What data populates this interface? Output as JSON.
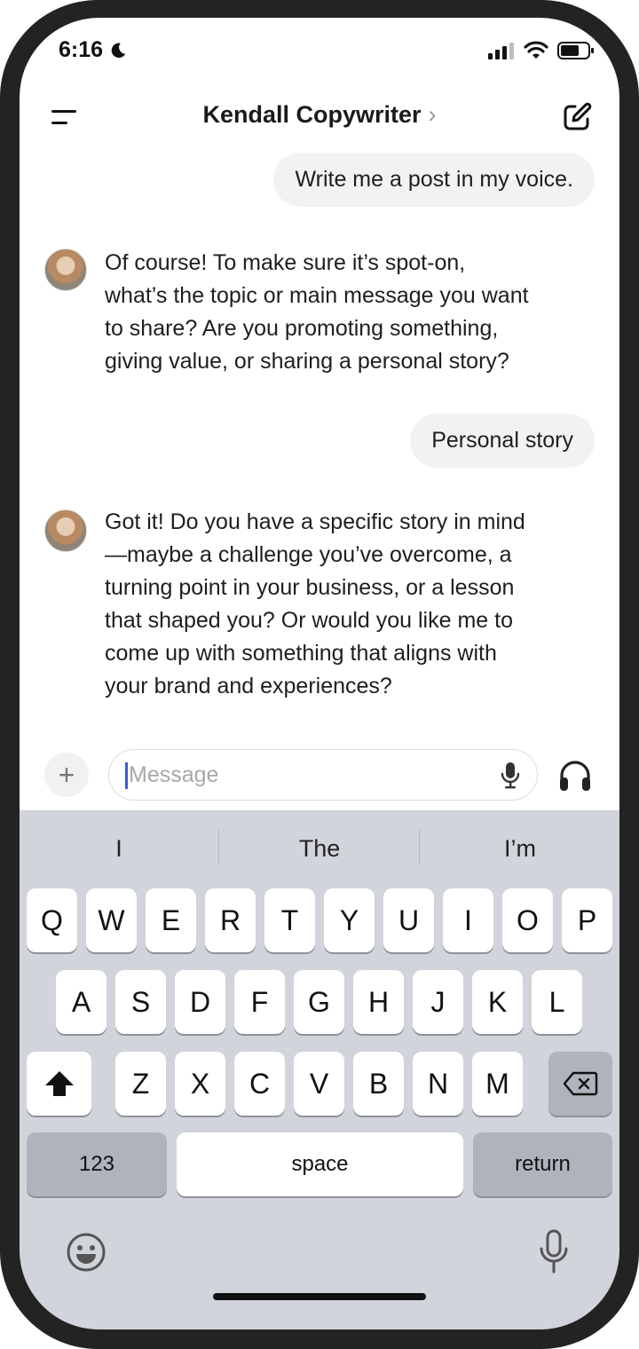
{
  "status_bar": {
    "time": "6:16"
  },
  "header": {
    "title": "Kendall Copywriter",
    "chevron": "›"
  },
  "conversation": {
    "messages": [
      {
        "role": "user",
        "text": "Write me a post in my voice."
      },
      {
        "role": "assistant",
        "lines": [
          "Of course! To make sure it’s spot-on,",
          "what’s the topic or main message you want",
          "to share? Are you promoting something,",
          "giving value, or sharing a personal story?"
        ]
      },
      {
        "role": "user",
        "text": "Personal story"
      },
      {
        "role": "assistant",
        "lines": [
          "Got it! Do you have a specific story in mind",
          "—maybe a challenge you’ve overcome, a",
          "turning point in your business, or a lesson",
          "that shaped you? Or would you like me to",
          "come up with something that aligns with",
          "your brand and experiences?"
        ]
      }
    ]
  },
  "composer": {
    "plus": "+",
    "placeholder": "Message",
    "value": ""
  },
  "keyboard": {
    "suggestions": [
      "I",
      "The",
      "I’m"
    ],
    "row1": [
      "Q",
      "W",
      "E",
      "R",
      "T",
      "Y",
      "U",
      "I",
      "O",
      "P"
    ],
    "row2": [
      "A",
      "S",
      "D",
      "F",
      "G",
      "H",
      "J",
      "K",
      "L"
    ],
    "row3": [
      "Z",
      "X",
      "C",
      "V",
      "B",
      "N",
      "M"
    ],
    "numbers_key": "123",
    "space_key": "space",
    "return_key": "return"
  },
  "icons": {
    "menu": "hamburger-icon",
    "compose": "compose-icon",
    "mic": "microphone-icon",
    "voice": "headphones-icon",
    "shift": "shift-icon",
    "delete": "backspace-icon",
    "emoji": "emoji-icon",
    "dictation": "dictation-mic-icon"
  }
}
